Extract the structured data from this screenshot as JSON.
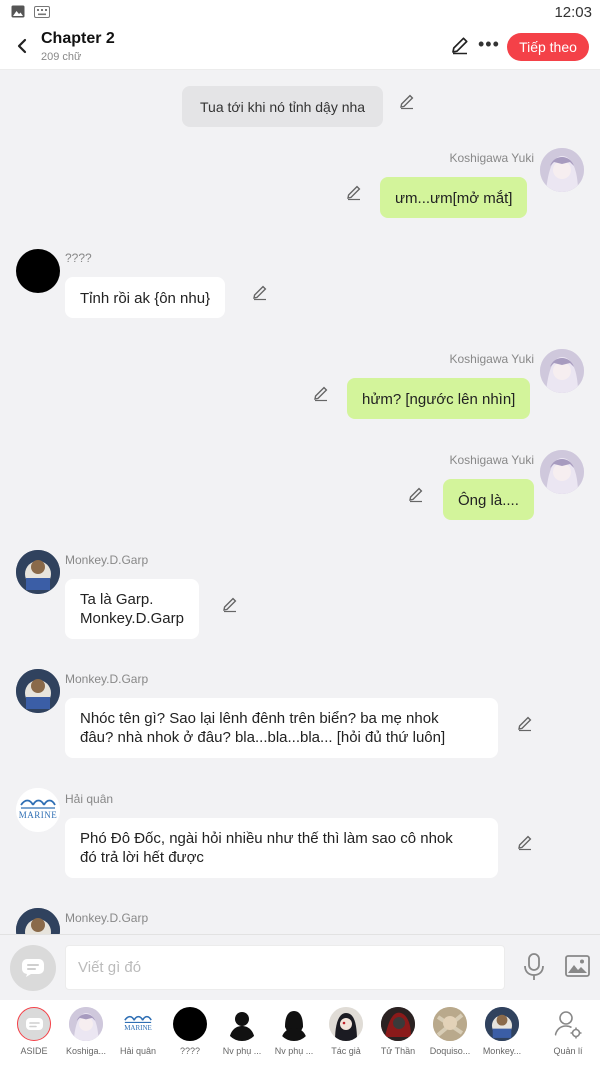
{
  "status_bar": {
    "time": "12:03"
  },
  "header": {
    "title": "Chapter 2",
    "subtitle": "209 chữ",
    "follow_label": "Tiếp theo"
  },
  "messages": [
    {
      "type": "narration",
      "text": "Tua tới khi nó tỉnh dậy nha"
    },
    {
      "side": "right",
      "name": "Koshigawa Yuki",
      "text": "ưm...ưm[mở mắt]"
    },
    {
      "side": "left",
      "name": "????",
      "text": "Tỉnh rồi ak {ôn nhu}"
    },
    {
      "side": "right",
      "name": "Koshigawa Yuki",
      "text": "hửm? [ngước lên nhìn]"
    },
    {
      "side": "right",
      "name": "Koshigawa Yuki",
      "text": "Ông là...."
    },
    {
      "side": "left",
      "name": "Monkey.D.Garp",
      "text_lines": [
        "Ta là Garp.",
        "Monkey.D.Garp"
      ]
    },
    {
      "side": "left",
      "name": "Monkey.D.Garp",
      "text_lines": [
        "Nhóc tên gì? Sao lại lênh đênh trên biển? ba mẹ nhok",
        "đâu? nhà nhok ở đâu? bla...bla...bla... [hỏi đủ thứ luôn]"
      ]
    },
    {
      "side": "left",
      "name": "Hải quân",
      "text_lines": [
        "Phó Đô Đốc, ngài hỏi nhiều như thế thì làm sao cô nhok",
        "đó trả lời hết được"
      ]
    },
    {
      "side": "left",
      "name": "Monkey.D.Garp",
      "text": ""
    }
  ],
  "marine_logo_text": "MARINE",
  "input": {
    "placeholder": "Viết gì đó"
  },
  "characters": [
    {
      "label": "ASIDE"
    },
    {
      "label": "Koshiga..."
    },
    {
      "label": "Hải quân"
    },
    {
      "label": "????"
    },
    {
      "label": "Nv phụ ..."
    },
    {
      "label": "Nv phụ ..."
    },
    {
      "label": "Tác giả"
    },
    {
      "label": "Tử Thần"
    },
    {
      "label": "Doquiso..."
    },
    {
      "label": "Monkey..."
    },
    {
      "label": "Quản lí"
    }
  ],
  "colors": {
    "accent": "#f44148",
    "bubble_green": "#d3f49b",
    "bubble_white": "#ffffff"
  }
}
